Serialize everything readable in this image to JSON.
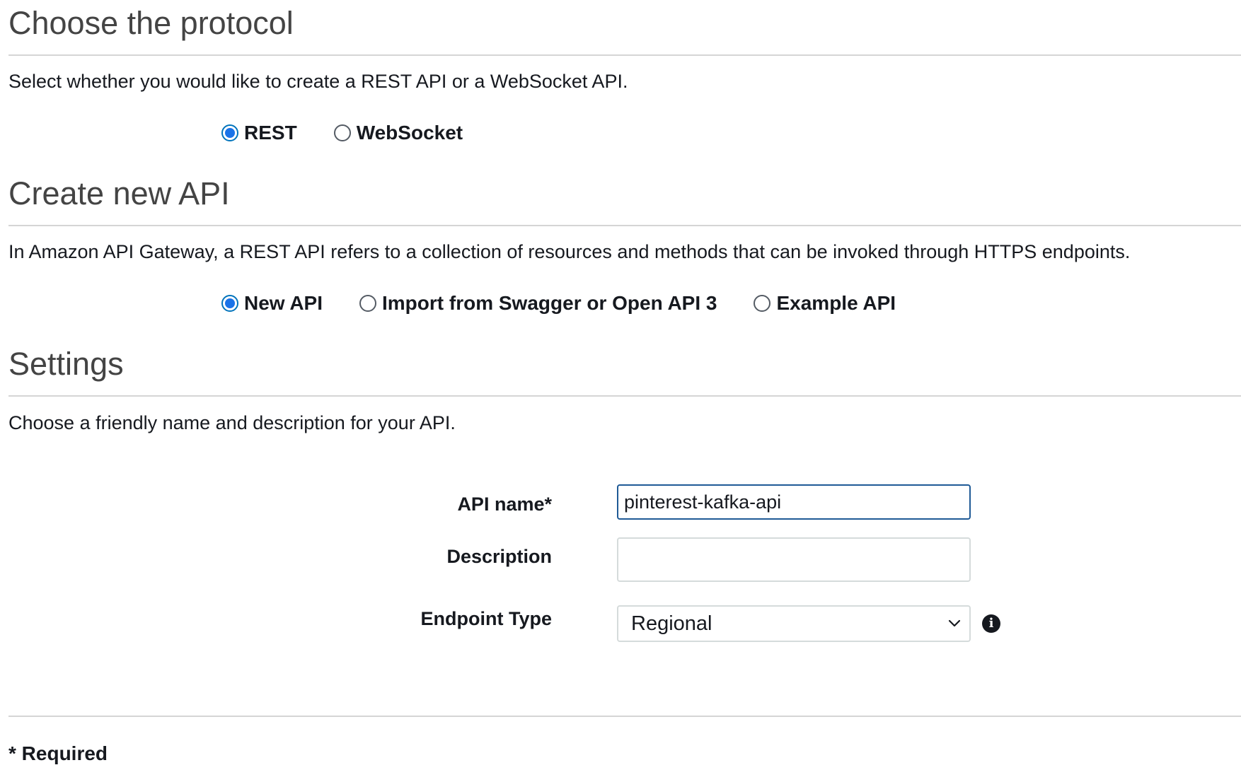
{
  "protocol_section": {
    "title": "Choose the protocol",
    "description": "Select whether you would like to create a REST API or a WebSocket API.",
    "options": [
      {
        "label": "REST",
        "selected": true
      },
      {
        "label": "WebSocket",
        "selected": false
      }
    ]
  },
  "create_section": {
    "title": "Create new API",
    "description": "In Amazon API Gateway, a REST API refers to a collection of resources and methods that can be invoked through HTTPS endpoints.",
    "options": [
      {
        "label": "New API",
        "selected": true
      },
      {
        "label": "Import from Swagger or Open API 3",
        "selected": false
      },
      {
        "label": "Example API",
        "selected": false
      }
    ]
  },
  "settings_section": {
    "title": "Settings",
    "description": "Choose a friendly name and description for your API.",
    "api_name": {
      "label": "API name*",
      "value": "pinterest-kafka-api"
    },
    "description_field": {
      "label": "Description",
      "value": ""
    },
    "endpoint_type": {
      "label": "Endpoint Type",
      "selected": "Regional",
      "info_icon": "info-icon"
    }
  },
  "footer": {
    "required_note": "* Required"
  },
  "colors": {
    "accent": "#0073bb",
    "radio_selected": "#1a73e8",
    "focus_border": "#1f5a96",
    "heading": "#444444",
    "text": "#16191f"
  }
}
